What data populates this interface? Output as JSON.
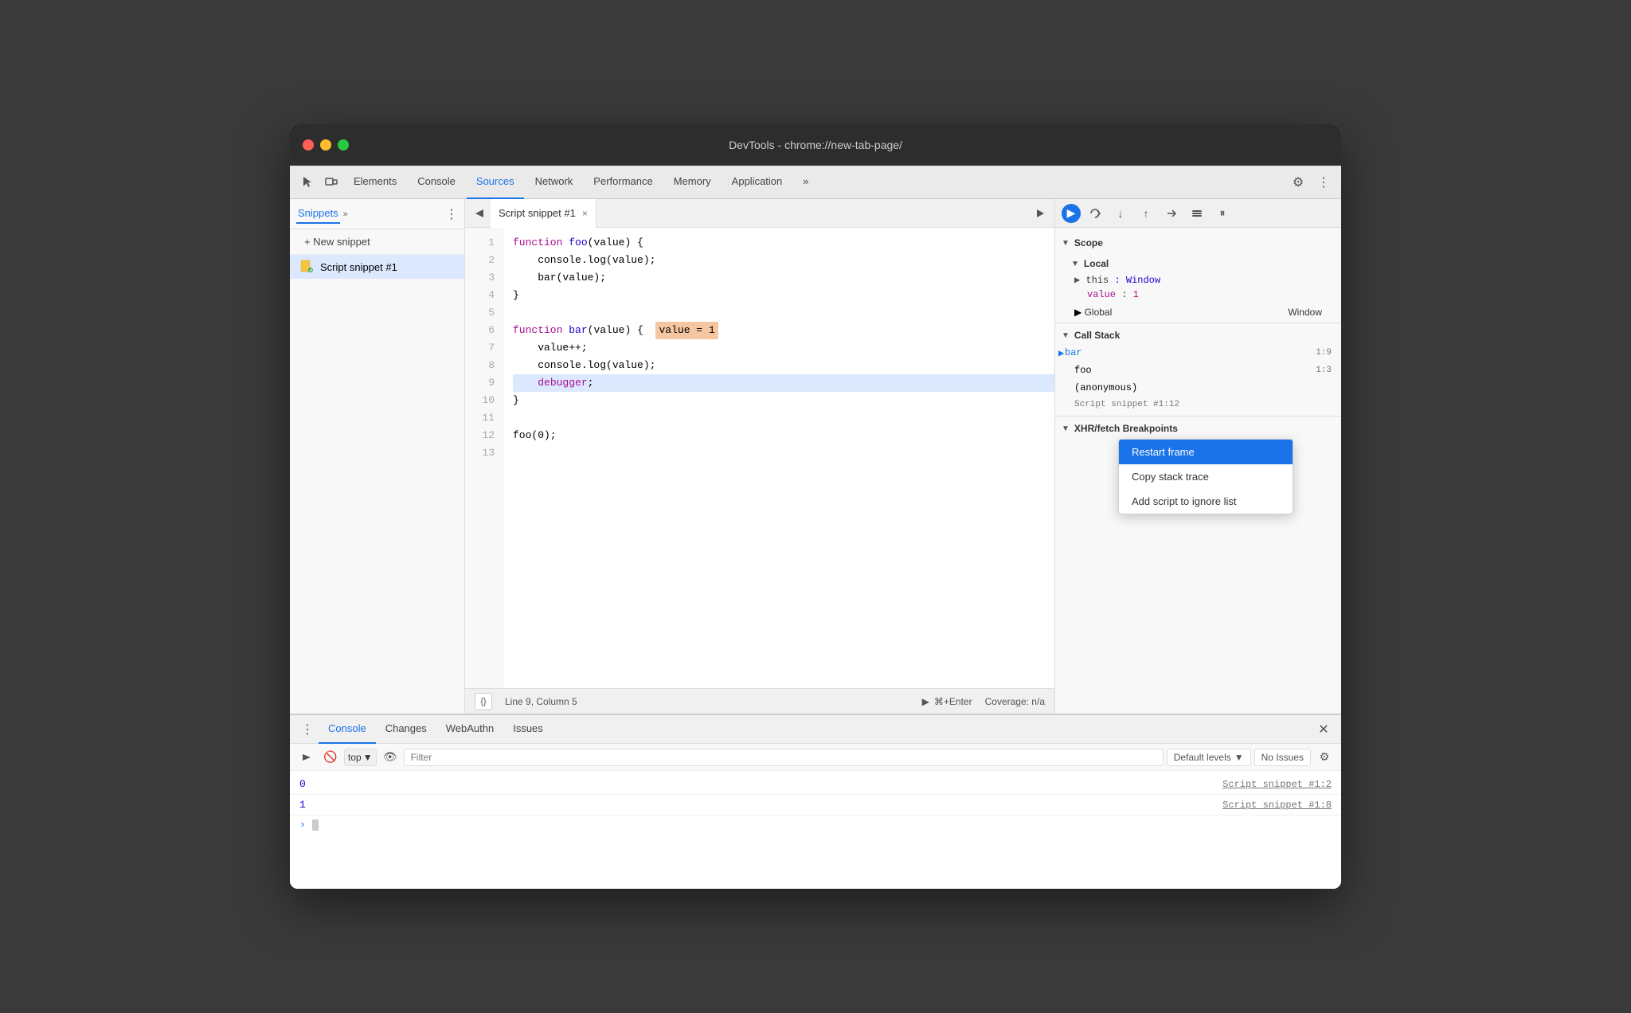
{
  "window": {
    "title": "DevTools - chrome://new-tab-page/"
  },
  "tabs": {
    "items": [
      {
        "label": "Elements",
        "active": false
      },
      {
        "label": "Console",
        "active": false
      },
      {
        "label": "Sources",
        "active": true
      },
      {
        "label": "Network",
        "active": false
      },
      {
        "label": "Performance",
        "active": false
      },
      {
        "label": "Memory",
        "active": false
      },
      {
        "label": "Application",
        "active": false
      }
    ],
    "more_label": "»"
  },
  "sidebar": {
    "tab_label": "Snippets",
    "chevron": "»",
    "more": "⋮",
    "new_snippet_label": "+ New snippet",
    "items": [
      {
        "name": "Script snippet #1",
        "active": true
      }
    ]
  },
  "editor": {
    "tab_label": "Script snippet #1",
    "close_icon": "×",
    "lines": [
      {
        "num": 1,
        "text": "function foo(value) {",
        "highlighted": false
      },
      {
        "num": 2,
        "text": "    console.log(value);",
        "highlighted": false
      },
      {
        "num": 3,
        "text": "    bar(value);",
        "highlighted": false
      },
      {
        "num": 4,
        "text": "}",
        "highlighted": false
      },
      {
        "num": 5,
        "text": "",
        "highlighted": false
      },
      {
        "num": 6,
        "text": "function bar(value) {",
        "highlighted": false,
        "has_badge": true,
        "badge_text": "value = 1"
      },
      {
        "num": 7,
        "text": "    value++;",
        "highlighted": false
      },
      {
        "num": 8,
        "text": "    console.log(value);",
        "highlighted": false
      },
      {
        "num": 9,
        "text": "    debugger;",
        "highlighted": true
      },
      {
        "num": 10,
        "text": "}",
        "highlighted": false
      },
      {
        "num": 11,
        "text": "",
        "highlighted": false
      },
      {
        "num": 12,
        "text": "foo(0);",
        "highlighted": false
      },
      {
        "num": 13,
        "text": "",
        "highlighted": false
      }
    ],
    "status_bar": {
      "line_col": "Line 9, Column 5",
      "run_hint": "⌘+Enter",
      "coverage": "Coverage: n/a"
    }
  },
  "right_panel": {
    "scope_section": "Scope",
    "local_section": "Local",
    "this_label": "this",
    "this_value": "Window",
    "value_label": "value",
    "value_value": "1",
    "global_section": "Global",
    "global_value": "Window",
    "call_stack_section": "Call Stack",
    "call_stack_items": [
      {
        "name": "bar",
        "loc": "1:9",
        "active": true
      },
      {
        "name": "foo",
        "loc": "1:3"
      },
      {
        "name": "(anonymous)",
        "loc": ""
      },
      {
        "name": "Script snippet #1:12",
        "loc": ""
      }
    ],
    "xhr_section": "XHR/fetch Breakpoints"
  },
  "context_menu": {
    "items": [
      {
        "label": "Restart frame",
        "selected": true
      },
      {
        "label": "Copy stack trace",
        "selected": false
      },
      {
        "label": "Add script to ignore list",
        "selected": false
      }
    ]
  },
  "bottom_panel": {
    "tabs": [
      {
        "label": "Console",
        "active": true
      },
      {
        "label": "Changes",
        "active": false
      },
      {
        "label": "WebAuthn",
        "active": false
      },
      {
        "label": "Issues",
        "active": false
      }
    ],
    "toolbar": {
      "top_label": "top",
      "filter_placeholder": "Filter",
      "levels_label": "Default levels",
      "no_issues_label": "No Issues"
    },
    "log_entries": [
      {
        "value": "0",
        "source": "Script snippet #1:2"
      },
      {
        "value": "1",
        "source": "Script snippet #1:8"
      }
    ]
  }
}
